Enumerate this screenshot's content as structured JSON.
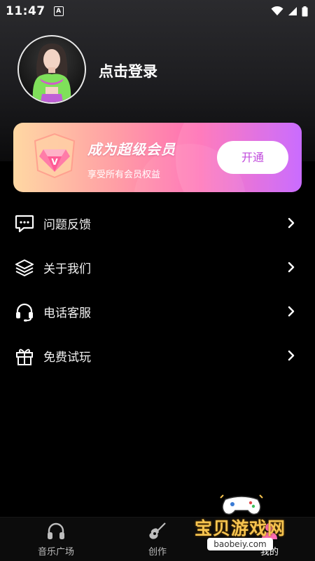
{
  "status_bar": {
    "time": "11:47",
    "badge": "A",
    "icons": [
      "wifi-icon",
      "signal-icon",
      "battery-icon"
    ]
  },
  "profile": {
    "login_text": "点击登录"
  },
  "vip": {
    "title": "成为超级会员",
    "subtitle": "享受所有会员权益",
    "button_label": "开通"
  },
  "menu": {
    "items": [
      {
        "label": "问题反馈",
        "icon": "feedback-icon"
      },
      {
        "label": "关于我们",
        "icon": "layers-icon"
      },
      {
        "label": "电话客服",
        "icon": "headset-icon"
      },
      {
        "label": "免费试玩",
        "icon": "gift-icon"
      }
    ]
  },
  "bottom_nav": {
    "items": [
      {
        "label": "音乐广场",
        "icon": "headphones-icon"
      },
      {
        "label": "创作",
        "icon": "guitar-icon"
      },
      {
        "label": "我的",
        "icon": "user-icon"
      }
    ]
  },
  "watermark": {
    "text": "宝贝游戏网",
    "url": "baobeiy.com"
  },
  "colors": {
    "accent": "#c14bdc",
    "background": "#000000",
    "watermark_gold": "#f6c44f"
  }
}
